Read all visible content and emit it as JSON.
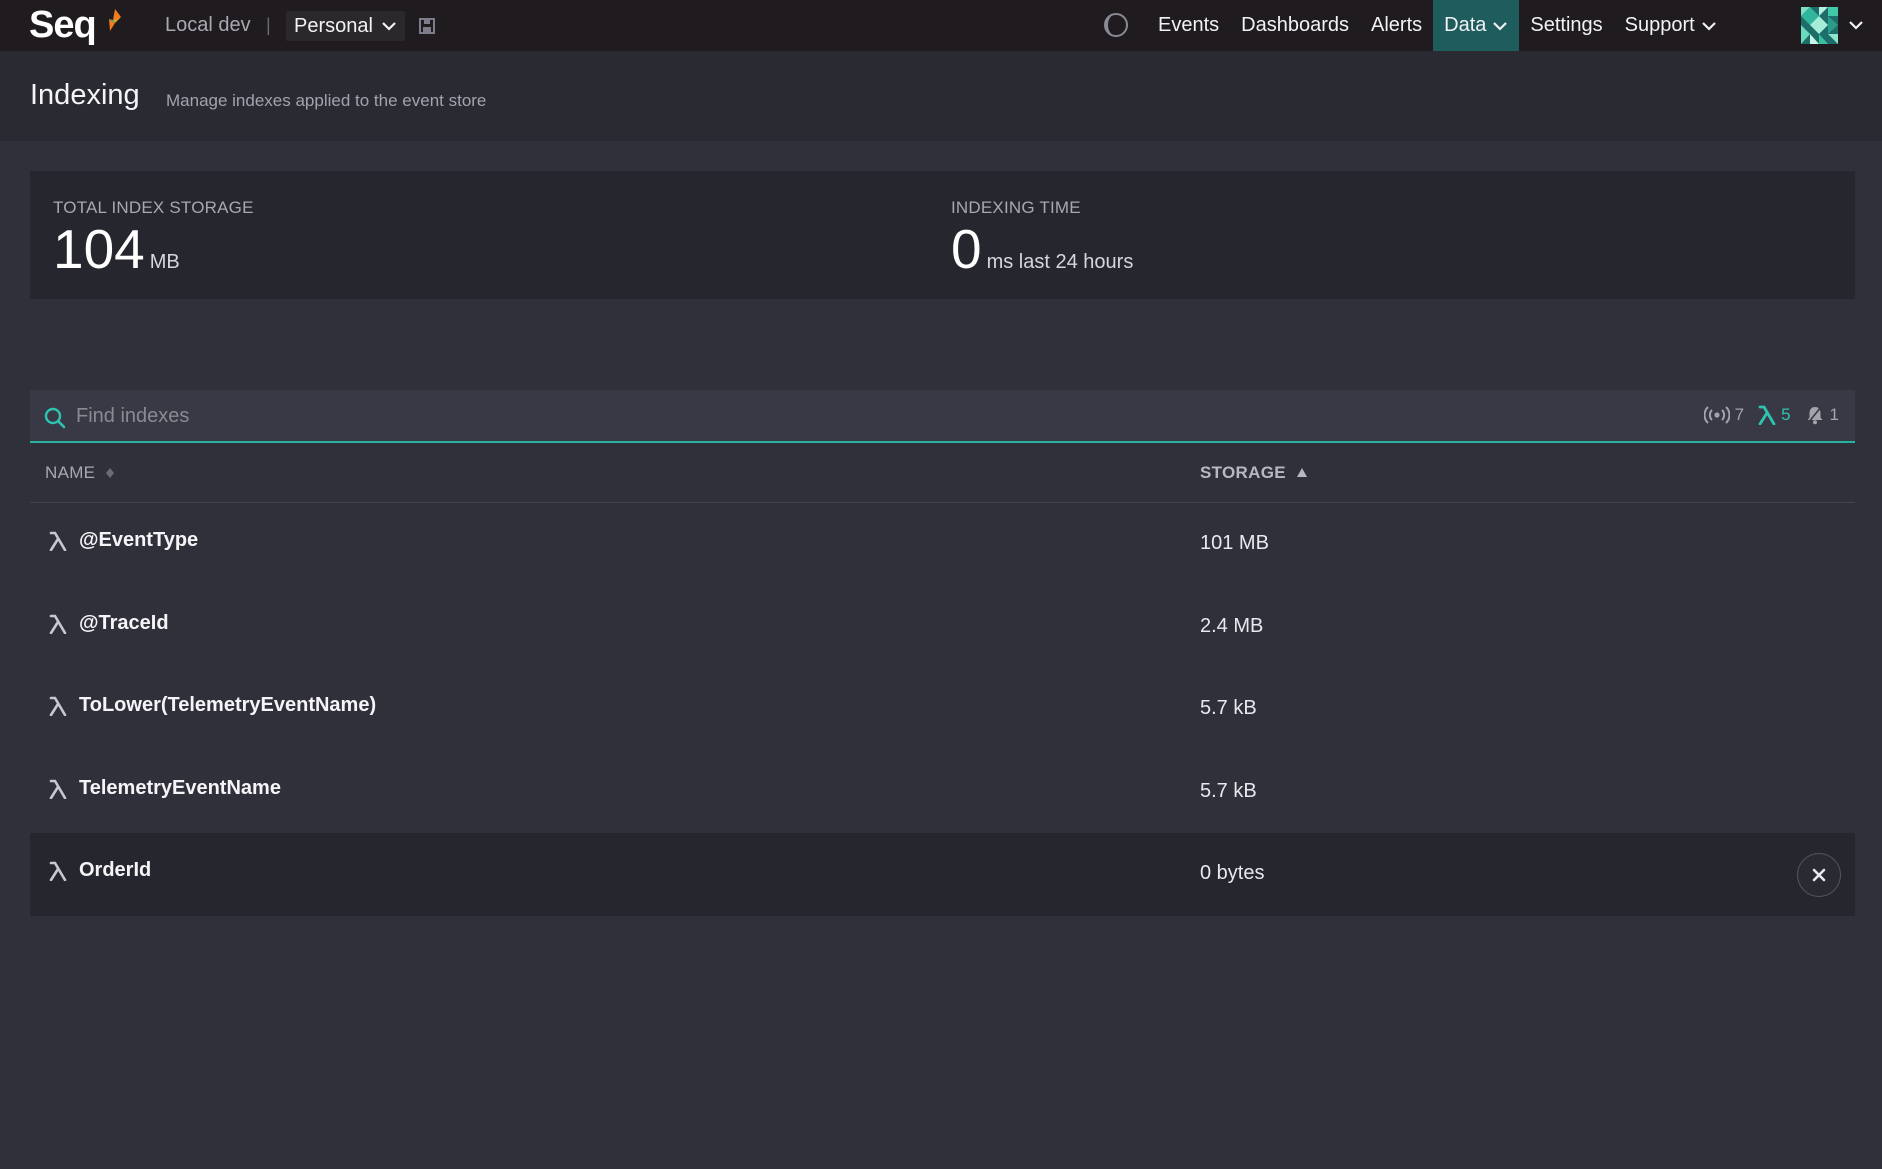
{
  "header": {
    "logo_text": "Seq",
    "instance": "Local dev",
    "separator": "|",
    "workspace": "Personal",
    "nav": [
      {
        "label": "Events"
      },
      {
        "label": "Dashboards"
      },
      {
        "label": "Alerts"
      },
      {
        "label": "Data",
        "active": true
      },
      {
        "label": "Settings"
      },
      {
        "label": "Support"
      }
    ],
    "icons": {
      "theme": "theme-toggle-icon",
      "workspace_extra": "workspace-icon",
      "avatar": "user-avatar",
      "chevron": "chevron-down-icon"
    }
  },
  "page": {
    "title": "Indexing",
    "subtitle": "Manage indexes applied to the event store"
  },
  "stats": {
    "storage": {
      "label": "TOTAL INDEX STORAGE",
      "value": "104",
      "unit": "MB"
    },
    "time": {
      "label": "INDEXING TIME",
      "value": "0",
      "unit": "ms last 24 hours"
    }
  },
  "search": {
    "placeholder": "Find indexes",
    "value": "",
    "filters": [
      {
        "icon": "signal-icon",
        "count": "7"
      },
      {
        "icon": "lambda-icon",
        "count": "5",
        "active": true
      },
      {
        "icon": "bell-icon",
        "count": "1"
      }
    ]
  },
  "table": {
    "columns": [
      {
        "label": "NAME",
        "sort": "none"
      },
      {
        "label": "STORAGE",
        "sort": "ascending"
      }
    ],
    "rows": [
      {
        "name": "@EventType",
        "storage": "101 MB"
      },
      {
        "name": "@TraceId",
        "storage": "2.4 MB"
      },
      {
        "name": "ToLower(TelemetryEventName)",
        "storage": "5.7 kB"
      },
      {
        "name": "TelemetryEventName",
        "storage": "5.7 kB"
      },
      {
        "name": "OrderId",
        "storage": "0 bytes",
        "hovered": true
      }
    ]
  },
  "colors": {
    "topbar": "#1f1b1f",
    "background": "#30303b",
    "panel": "#26262e",
    "accent": "#26b3a4",
    "nav_active": "#1f5c5e",
    "flame_orange": "#f47b20",
    "flame_green": "#3fbf7f"
  }
}
